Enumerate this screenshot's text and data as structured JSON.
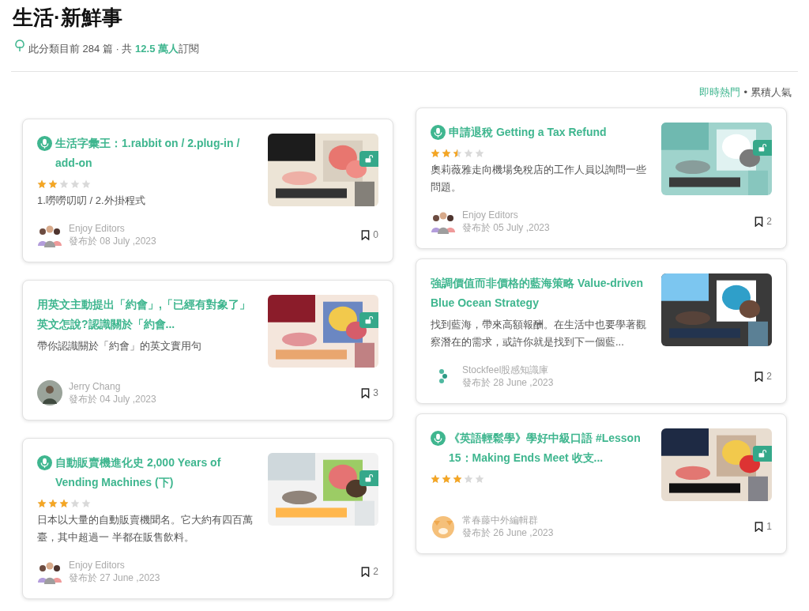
{
  "header": {
    "title": "生活·新鮮事",
    "summary": {
      "prefix": "此分類目前 284 篇 · 共",
      "highlight": "12.5 萬人",
      "suffix": "訂閱"
    }
  },
  "sort": [
    {
      "label": "即時熱門",
      "selected": true
    },
    {
      "label": "累積人氣",
      "selected": false
    }
  ],
  "sort_separator": "•",
  "columns": [
    [
      {
        "audio": true,
        "title": "生活字彙王：1.rabbit on / 2.plug-in / add-on",
        "stars": 2,
        "description": "1.嘮嘮叨叨 / 2.外掛程式",
        "author": "Enjoy Editors",
        "avatar": {
          "kind": "group"
        },
        "date": "發布於 08 July ,2023",
        "bookmarks": "0",
        "locked": true
      },
      {
        "audio": false,
        "title": "用英文主動提出「約會」,「已經有對象了」英文怎說?認識關於「約會...",
        "description": "帶你認識關於「約會」的英文實用句",
        "author": "Jerry Chang",
        "avatar": {
          "kind": "person"
        },
        "date": "發布於 04 July ,2023",
        "bookmarks": "3",
        "locked": true
      },
      {
        "audio": true,
        "title": "自動販賣機進化史 2,000 Years of Vending Machines (下)",
        "stars": 3,
        "description": "日本以大量的自動販賣機聞名。它大約有四百萬臺，其中超過一 半都在販售飲料。",
        "author": "Enjoy Editors",
        "avatar": {
          "kind": "group"
        },
        "date": "發布於 27 June ,2023",
        "bookmarks": "2",
        "locked": true
      }
    ],
    [
      {
        "audio": true,
        "title": "申請退稅 Getting a Tax Refund",
        "stars": 2.5,
        "description": "奧莉薇雅走向機場免稅店的工作人員以詢問一些問題。",
        "author": "Enjoy Editors",
        "avatar": {
          "kind": "group"
        },
        "date": "發布於 05 July ,2023",
        "bookmarks": "2",
        "locked": true
      },
      {
        "audio": false,
        "title": "強調價值而非價格的藍海策略 Value-driven Blue Ocean Strategy",
        "description": "找到藍海，帶來高額報酬。在生活中也要學著觀察潛在的需求，或許你就是找到下一個藍...",
        "author": "Stockfeel股感知識庫",
        "avatar": {
          "kind": "logo"
        },
        "date": "發布於 28 June ,2023",
        "bookmarks": "2",
        "locked": false
      },
      {
        "audio": true,
        "title": "《英語輕鬆學》學好中級口語 #Lesson 15：Making Ends Meet 收支...",
        "stars": 3,
        "author": "常春藤中外編輯群",
        "avatar": {
          "kind": "cat"
        },
        "date": "發布於 26 June ,2023",
        "bookmarks": "1",
        "locked": true
      }
    ]
  ]
}
